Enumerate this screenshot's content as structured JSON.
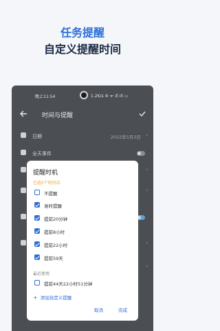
{
  "promo": {
    "line1": "任务提醒",
    "line2": "自定义提醒时间"
  },
  "statusbar": {
    "time": "晚上11:54",
    "right": "1.2K/s ✲ ᯤ ıll ıll ▭"
  },
  "appbar": {
    "title": "时间与提醒"
  },
  "rows": {
    "date": {
      "label": "日期",
      "value": "2022年5月3日"
    },
    "allday": {
      "label": "全天事件"
    }
  },
  "dialog": {
    "title": "提醒时机",
    "selected_count": "已选5个时间点",
    "options": [
      {
        "label": "不提醒",
        "checked": false
      },
      {
        "label": "准时提醒",
        "checked": true
      },
      {
        "label": "提前20分钟",
        "checked": true
      },
      {
        "label": "提前8小时",
        "checked": true
      },
      {
        "label": "提前22小时",
        "checked": true
      },
      {
        "label": "提前59天",
        "checked": true
      }
    ],
    "recent_title": "最近使用",
    "recent": [
      {
        "label": "提前44天22小时51分钟",
        "checked": false
      }
    ],
    "add_label": "添加自定义提醒",
    "cancel": "取消",
    "done": "完成"
  },
  "colors": {
    "accent": "#2f6fd6",
    "hint": "#e8a531",
    "promo_title": "#2f6fd6"
  }
}
